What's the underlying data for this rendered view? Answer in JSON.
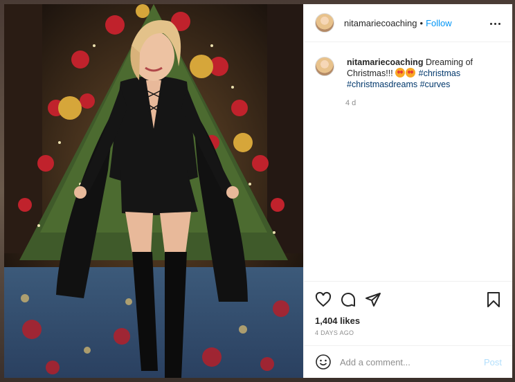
{
  "post": {
    "username": "nitamariecoaching",
    "separator": "•",
    "follow_label": "Follow",
    "caption": {
      "username": "nitamariecoaching",
      "text": "Dreaming of Christmas!!!",
      "emojis": [
        "heart-eyes-emoji",
        "heart-eyes-emoji"
      ],
      "hashtags": [
        "#christmas",
        "#christmasdreams",
        "#curves"
      ]
    },
    "caption_time": "4 d",
    "likes": "1,404 likes",
    "date": "4 DAYS AGO"
  },
  "comment": {
    "placeholder": "Add a comment...",
    "post_label": "Post"
  },
  "icons": {
    "more": "more-options-icon",
    "like": "heart-icon",
    "comment": "comment-icon",
    "share": "paper-plane-icon",
    "save": "bookmark-icon",
    "emoji": "smiley-icon"
  },
  "colors": {
    "accent": "#0095f6",
    "hashtag": "#00376b",
    "muted": "#8e8e8e",
    "post_disabled": "#b2dffc"
  }
}
